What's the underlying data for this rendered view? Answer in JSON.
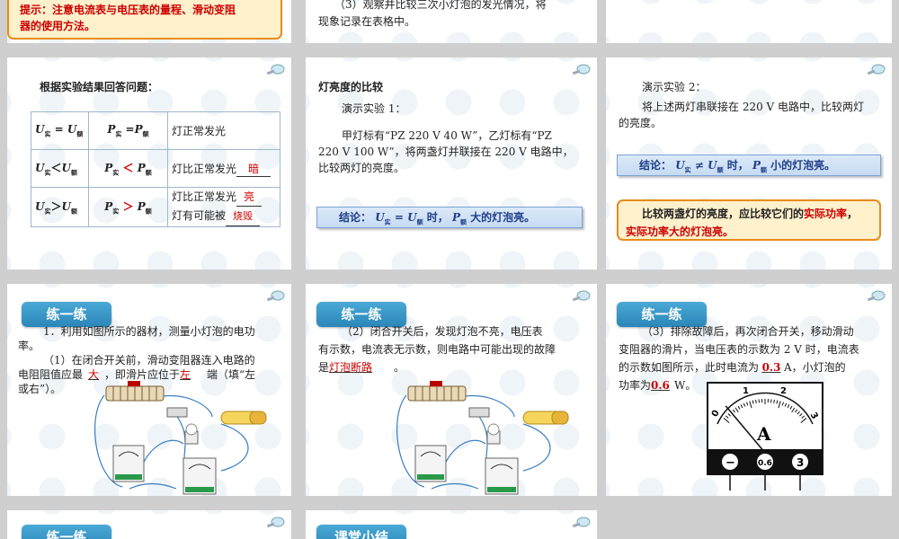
{
  "slide_r1_left": {
    "hint": "提示：注意电流表与电压表的量程、滑动变阻",
    "hint_line2": "器的使用方法。"
  },
  "slide_r1_mid": {
    "line1": "（3）观察并比较三次小灯泡的发光情况，将",
    "line2": "现象记录在表格中。"
  },
  "slide_table": {
    "heading": "根据实验结果回答问题：",
    "rows": [
      {
        "c3": "灯正常发光",
        "blank": ""
      },
      {
        "c3": "灯比正常发光",
        "blank": "暗"
      },
      {
        "c3": "灯比正常发光",
        "blank": "亮",
        "c3b": "灯有可能被",
        "blank2": "烧毁"
      }
    ],
    "u": "U",
    "p": "P",
    "sub_actual": "实",
    "sub_rated": "额"
  },
  "slide_parallel": {
    "heading": "灯亮度的比较",
    "demo": "演示实验 1：",
    "p1": "甲灯标有“PZ 220 V  40 W”，乙灯标有“PZ",
    "p2": "220 V  100 W”，将两盏灯并联接在 220 V 电路中，",
    "p3": "比较两灯的亮度。",
    "conclusion_pre": "结论：",
    "conclusion_mid": "时，",
    "conclusion_post": "大的灯泡亮。"
  },
  "slide_series": {
    "demo": "演示实验 2：",
    "p1": "将上述两灯串联接在 220 V 电路中，比较两灯",
    "p2": "的亮度。",
    "conclusion_pre": "结论：",
    "conclusion_mid": "时，",
    "conclusion_post": "小的灯泡亮。",
    "note1a": "比较两盏灯的亮度，应比较它们的",
    "note1b": "实际功率",
    "note1c": "，",
    "note2": "实际功率大的灯泡亮。"
  },
  "practice_label": "练一练",
  "summary_label": "课堂小结",
  "practice1": {
    "p1": "1．利用如图所示的器材，测量小灯泡的电功",
    "p2": "率。",
    "p3": "（1）在闭合开关前，滑动变阻器连入电路的",
    "p4a": "电阻阻值应最",
    "a1": "大",
    "p4b": "，即滑片应位于",
    "a2": "左",
    "p4c": "端（填“左",
    "p5": "或右”）。"
  },
  "practice2": {
    "p1": "（2）闭合开关后，发现灯泡不亮，电压表",
    "p2": "有示数，电流表无示数，则电路中可能出现的故障",
    "p3a": "是",
    "a1": "灯泡断路",
    "p3b": "。"
  },
  "practice3": {
    "p1": "（3）排除故障后，再次闭合开关，移动滑动",
    "p2": "变阻器的滑片，当电压表的示数为 2 V 时，电流表",
    "p3a": "的示数如图所示，此时电流为",
    "a1": "0.3",
    "p3b": "A，小灯泡的",
    "p4a": "功率为",
    "a2": "0.6",
    "p4b": "W。"
  },
  "ammeter": {
    "unit": "A",
    "scale": [
      "0",
      "1",
      "2",
      "3"
    ],
    "terminals": [
      "−",
      "0.6",
      "3"
    ],
    "reading": 0.3
  }
}
